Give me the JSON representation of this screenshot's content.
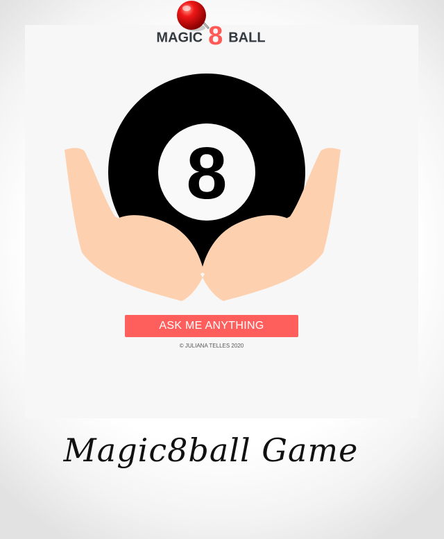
{
  "app": {
    "title_left": "MAGIC",
    "title_eight": "8",
    "title_right": "BALL",
    "accent_color": "#ff5a55"
  },
  "ball": {
    "number": "8",
    "icon": "magic-8-ball-icon"
  },
  "hands": {
    "icon": "cupped-hands-icon",
    "skin_color": "#fdd0b0"
  },
  "pin": {
    "icon": "red-pushpin-icon"
  },
  "button": {
    "label": "ASK ME ANYTHING",
    "color": "#ff5f5c"
  },
  "footer": {
    "copyright": "© JULIANA TELLES 2020"
  },
  "caption": {
    "text": "Magic8ball Game"
  }
}
